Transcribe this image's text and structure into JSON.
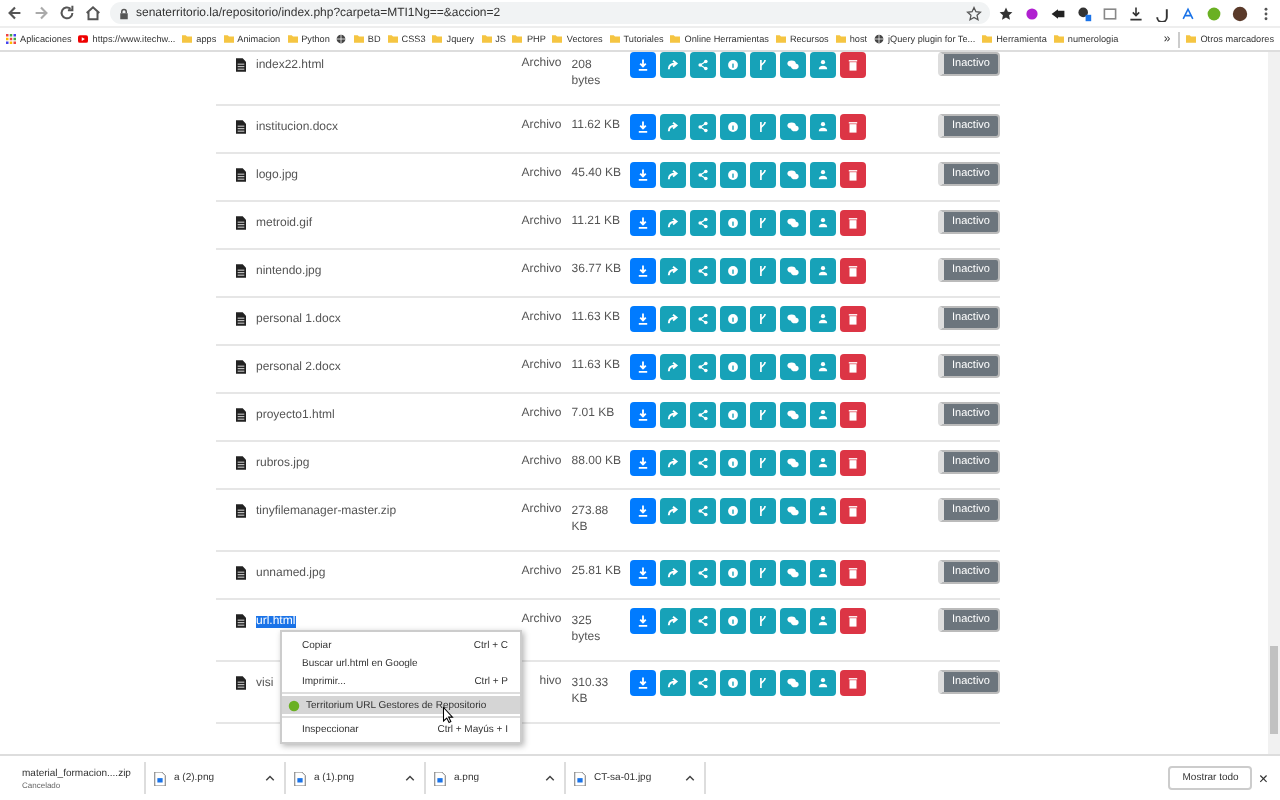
{
  "browser": {
    "url": "senaterritorio.la/repositorio/index.php?carpeta=MTI1Ng==&accion=2",
    "bookmarks": [
      {
        "label": "Aplicaciones",
        "kind": "apps"
      },
      {
        "label": "https://www.itechw...",
        "kind": "video"
      },
      {
        "label": "apps",
        "kind": "folder"
      },
      {
        "label": "Animacion",
        "kind": "folder"
      },
      {
        "label": "Python",
        "kind": "folder"
      },
      {
        "kind": "globe"
      },
      {
        "label": "BD",
        "kind": "folder"
      },
      {
        "label": "CSS3",
        "kind": "folder"
      },
      {
        "label": "Jquery",
        "kind": "folder"
      },
      {
        "label": "JS",
        "kind": "folder"
      },
      {
        "label": "PHP",
        "kind": "folder"
      },
      {
        "label": "Vectores",
        "kind": "folder"
      },
      {
        "label": "Tutoriales",
        "kind": "folder"
      },
      {
        "label": "Online Herramientas",
        "kind": "folder"
      },
      {
        "label": "Recursos",
        "kind": "folder"
      },
      {
        "label": "host",
        "kind": "folder"
      },
      {
        "label": "jQuery plugin for Te...",
        "kind": "globe"
      },
      {
        "label": "Herramienta",
        "kind": "folder"
      },
      {
        "label": "numerologia",
        "kind": "folder"
      }
    ],
    "more": "»",
    "other_bookmarks": "Otros marcadores"
  },
  "files": [
    {
      "name": "index22.html",
      "type": "Archivo",
      "size": "208 bytes",
      "status": "Inactivo",
      "on": false,
      "selected": false,
      "tall": true
    },
    {
      "name": "institucion.docx",
      "type": "Archivo",
      "size": "11.62 KB",
      "status": "Inactivo",
      "on": false,
      "selected": false,
      "tall": false
    },
    {
      "name": "logo.jpg",
      "type": "Archivo",
      "size": "45.40 KB",
      "status": "Inactivo",
      "on": false,
      "selected": false,
      "tall": false
    },
    {
      "name": "metroid.gif",
      "type": "Archivo",
      "size": "11.21 KB",
      "status": "Inactivo",
      "on": false,
      "selected": false,
      "tall": false
    },
    {
      "name": "nintendo.jpg",
      "type": "Archivo",
      "size": "36.77 KB",
      "status": "Inactivo",
      "on": false,
      "selected": false,
      "tall": false
    },
    {
      "name": "personal 1.docx",
      "type": "Archivo",
      "size": "11.63 KB",
      "status": "Inactivo",
      "on": false,
      "selected": false,
      "tall": false
    },
    {
      "name": "personal 2.docx",
      "type": "Archivo",
      "size": "11.63 KB",
      "status": "Inactivo",
      "on": false,
      "selected": false,
      "tall": false
    },
    {
      "name": "proyecto1.html",
      "type": "Archivo",
      "size": "7.01 KB",
      "status": "Inactivo",
      "on": false,
      "selected": false,
      "tall": false
    },
    {
      "name": "rubros.jpg",
      "type": "Archivo",
      "size": "88.00 KB",
      "status": "Inactivo",
      "on": false,
      "selected": false,
      "tall": false
    },
    {
      "name": "tinyfilemanager-master.zip",
      "type": "Archivo",
      "size": "273.88 KB",
      "status": "Inactivo",
      "on": false,
      "selected": false,
      "tall": true
    },
    {
      "name": "unnamed.jpg",
      "type": "Archivo",
      "size": "25.81 KB",
      "status": "Inactivo",
      "on": false,
      "selected": false,
      "tall": false
    },
    {
      "name": "url.html",
      "type": "Archivo",
      "size": "325 bytes",
      "status": "Inactivo",
      "on": false,
      "selected": true,
      "tall": true
    },
    {
      "name": "visi",
      "type": "hivo",
      "size": "310.33 KB",
      "status": "Inactivo",
      "on": false,
      "selected": false,
      "tall": true
    }
  ],
  "context_menu": [
    {
      "label": "Copiar",
      "shortcut": "Ctrl + C",
      "selected": false,
      "kind": "item"
    },
    {
      "label": "Buscar url.html en Google",
      "selected": false,
      "kind": "item"
    },
    {
      "label": "Imprimir...",
      "shortcut": "Ctrl + P",
      "selected": false,
      "kind": "item"
    },
    {
      "label": "Territorium URL Gestores de Repositorio",
      "selected": true,
      "kind": "extension"
    },
    {
      "label": "Inspeccionar",
      "shortcut": "Ctrl + Mayús + I",
      "selected": false,
      "kind": "item"
    }
  ],
  "downloads": [
    {
      "name": "material_formacion....zip",
      "note": "Cancelado",
      "kind": "archive"
    },
    {
      "name": "a (2).png",
      "kind": "image"
    },
    {
      "name": "a (1).png",
      "kind": "image"
    },
    {
      "name": "a.png",
      "kind": "image"
    },
    {
      "name": "CT-sa-01.jpg",
      "kind": "image"
    }
  ],
  "show_all": "Mostrar todo",
  "close": "×"
}
